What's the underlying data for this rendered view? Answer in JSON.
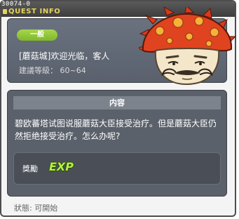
{
  "window": {
    "quest_id": "30074-0",
    "title": "QUEST INFO"
  },
  "header": {
    "category": "一般",
    "quest_title": "[蘑菇城]欢迎光临，客人",
    "level_range": "建議等級： 60~64"
  },
  "content": {
    "heading": "内容",
    "description": "碧欧蕃塔试图说服蘑菇大臣接受治疗。但是蘑菇大臣仍然拒绝接受治疗。怎么办呢?"
  },
  "reward": {
    "label": "獎勵",
    "item": "EXP"
  },
  "status": {
    "text": "狀態:   可開始"
  },
  "colors": {
    "title_accent": "#e6d45b",
    "badge_green": "#8cc63f",
    "exp_green": "#b6f04a"
  },
  "icons": [
    "lock-icon",
    "mushroom-npc-portrait",
    "exp-icon"
  ]
}
